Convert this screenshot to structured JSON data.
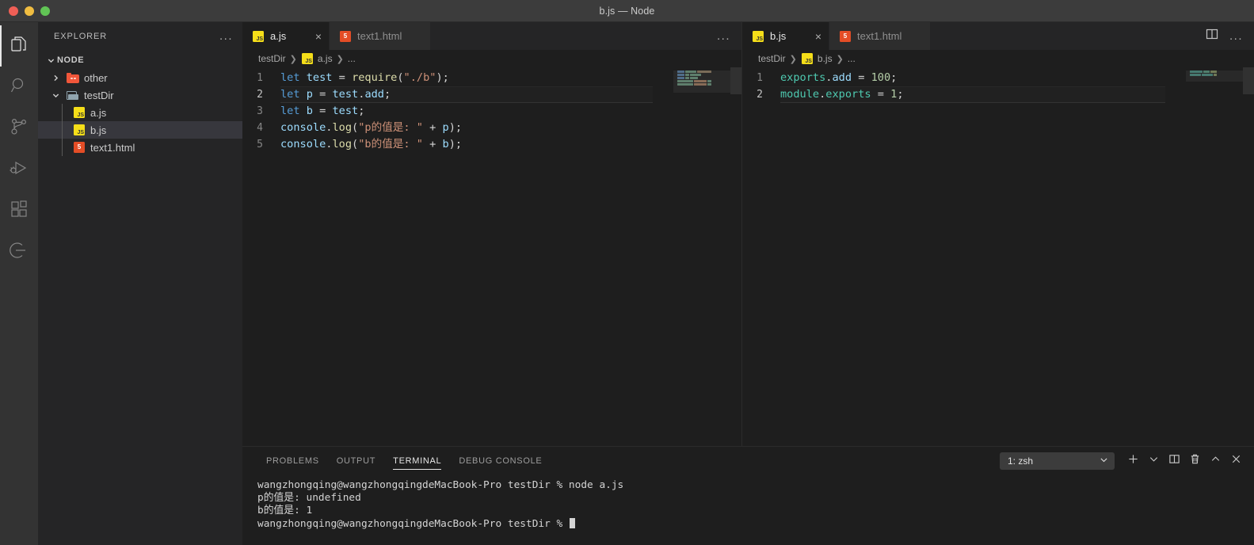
{
  "window": {
    "title": "b.js — Node",
    "traffic_lights": [
      "close",
      "minimize",
      "maximize"
    ]
  },
  "activitybar": {
    "items": [
      {
        "name": "explorer",
        "icon": "files-icon",
        "active": true
      },
      {
        "name": "search",
        "icon": "search-icon",
        "active": false
      },
      {
        "name": "source-control",
        "icon": "source-control-icon",
        "active": false
      },
      {
        "name": "run-and-debug",
        "icon": "run-debug-icon",
        "active": false
      },
      {
        "name": "extensions",
        "icon": "extensions-icon",
        "active": false
      },
      {
        "name": "remote-explorer",
        "icon": "remote-plug-icon",
        "active": false
      }
    ]
  },
  "sidebar": {
    "header": {
      "title": "EXPLORER",
      "more_actions": "..."
    },
    "root": {
      "label": "NODE",
      "expanded": true
    },
    "tree": [
      {
        "label": "other",
        "type": "folder",
        "icon": "folder-node-icon",
        "expanded": false,
        "indent": 1,
        "selected": false
      },
      {
        "label": "testDir",
        "type": "folder",
        "icon": "folder-open-icon",
        "expanded": true,
        "indent": 1,
        "selected": false
      },
      {
        "label": "a.js",
        "type": "file",
        "icon": "js-file-icon",
        "indent": 2,
        "selected": false
      },
      {
        "label": "b.js",
        "type": "file",
        "icon": "js-file-icon",
        "indent": 2,
        "selected": true
      },
      {
        "label": "text1.html",
        "type": "file",
        "icon": "html-file-icon",
        "indent": 2,
        "selected": false
      }
    ]
  },
  "editor_groups": [
    {
      "id": "left",
      "tabs": [
        {
          "label": "a.js",
          "icon": "js-file-icon",
          "active": true,
          "close": "×"
        },
        {
          "label": "text1.html",
          "icon": "html-file-icon",
          "active": false,
          "close": "×"
        }
      ],
      "actions": {
        "more": "..."
      },
      "breadcrumb": [
        {
          "label": "testDir",
          "icon": null
        },
        {
          "label": "a.js",
          "icon": "js-file-icon"
        },
        {
          "label": "...",
          "icon": null
        }
      ],
      "lines": [
        {
          "n": "1",
          "current": false,
          "tokens": [
            {
              "t": "let",
              "c": "kw"
            },
            {
              "t": " ",
              "c": "plain"
            },
            {
              "t": "test",
              "c": "var"
            },
            {
              "t": " ",
              "c": "plain"
            },
            {
              "t": "=",
              "c": "plain"
            },
            {
              "t": " ",
              "c": "plain"
            },
            {
              "t": "require",
              "c": "fn"
            },
            {
              "t": "(",
              "c": "plain"
            },
            {
              "t": "\"./b\"",
              "c": "str"
            },
            {
              "t": ");",
              "c": "plain"
            }
          ]
        },
        {
          "n": "2",
          "current": true,
          "tokens": [
            {
              "t": "let",
              "c": "kw"
            },
            {
              "t": " ",
              "c": "plain"
            },
            {
              "t": "p",
              "c": "var"
            },
            {
              "t": " = ",
              "c": "plain"
            },
            {
              "t": "test",
              "c": "var"
            },
            {
              "t": ".",
              "c": "plain"
            },
            {
              "t": "add",
              "c": "var"
            },
            {
              "t": ";",
              "c": "plain"
            }
          ]
        },
        {
          "n": "3",
          "current": false,
          "tokens": [
            {
              "t": "let",
              "c": "kw"
            },
            {
              "t": " ",
              "c": "plain"
            },
            {
              "t": "b",
              "c": "var"
            },
            {
              "t": " = ",
              "c": "plain"
            },
            {
              "t": "test",
              "c": "var"
            },
            {
              "t": ";",
              "c": "plain"
            }
          ]
        },
        {
          "n": "4",
          "current": false,
          "tokens": [
            {
              "t": "console",
              "c": "var"
            },
            {
              "t": ".",
              "c": "plain"
            },
            {
              "t": "log",
              "c": "fn"
            },
            {
              "t": "(",
              "c": "plain"
            },
            {
              "t": "\"p的值是: \"",
              "c": "str"
            },
            {
              "t": " + ",
              "c": "plain"
            },
            {
              "t": "p",
              "c": "var"
            },
            {
              "t": ");",
              "c": "plain"
            }
          ]
        },
        {
          "n": "5",
          "current": false,
          "tokens": [
            {
              "t": "console",
              "c": "var"
            },
            {
              "t": ".",
              "c": "plain"
            },
            {
              "t": "log",
              "c": "fn"
            },
            {
              "t": "(",
              "c": "plain"
            },
            {
              "t": "\"b的值是: \"",
              "c": "str"
            },
            {
              "t": " + ",
              "c": "plain"
            },
            {
              "t": "b",
              "c": "var"
            },
            {
              "t": ");",
              "c": "plain"
            }
          ]
        }
      ]
    },
    {
      "id": "right",
      "tabs": [
        {
          "label": "b.js",
          "icon": "js-file-icon",
          "active": true,
          "close": "×"
        },
        {
          "label": "text1.html",
          "icon": "html-file-icon",
          "active": false,
          "close": "×"
        }
      ],
      "actions": {
        "split_editor": "split-editor-icon",
        "more": "..."
      },
      "breadcrumb": [
        {
          "label": "testDir",
          "icon": null
        },
        {
          "label": "b.js",
          "icon": "js-file-icon"
        },
        {
          "label": "...",
          "icon": null
        }
      ],
      "lines": [
        {
          "n": "1",
          "current": false,
          "tokens": [
            {
              "t": "exports",
              "c": "teal"
            },
            {
              "t": ".",
              "c": "plain"
            },
            {
              "t": "add",
              "c": "var"
            },
            {
              "t": " = ",
              "c": "plain"
            },
            {
              "t": "100",
              "c": "num"
            },
            {
              "t": ";",
              "c": "plain"
            }
          ]
        },
        {
          "n": "2",
          "current": true,
          "tokens": [
            {
              "t": "module",
              "c": "teal"
            },
            {
              "t": ".",
              "c": "plain"
            },
            {
              "t": "exports",
              "c": "teal"
            },
            {
              "t": " = ",
              "c": "plain"
            },
            {
              "t": "1",
              "c": "num"
            },
            {
              "t": ";",
              "c": "plain"
            }
          ]
        }
      ]
    }
  ],
  "panel": {
    "tabs": [
      {
        "label": "PROBLEMS",
        "active": false
      },
      {
        "label": "OUTPUT",
        "active": false
      },
      {
        "label": "TERMINAL",
        "active": true
      },
      {
        "label": "DEBUG CONSOLE",
        "active": false
      }
    ],
    "terminal_selector": {
      "value": "1: zsh",
      "chevron": "chevron-down-icon"
    },
    "actions": [
      {
        "name": "new-terminal",
        "icon": "plus-icon"
      },
      {
        "name": "terminal-options",
        "icon": "chevron-down-icon"
      },
      {
        "name": "split-terminal",
        "icon": "split-icon"
      },
      {
        "name": "kill-terminal",
        "icon": "trash-icon"
      },
      {
        "name": "maximize-panel",
        "icon": "chevron-up-icon"
      },
      {
        "name": "close-panel",
        "icon": "close-icon"
      }
    ],
    "terminal_lines": [
      "wangzhongqing@wangzhongqingdeMacBook-Pro testDir % node a.js",
      "p的值是: undefined",
      "b的值是: 1",
      "wangzhongqing@wangzhongqingdeMacBook-Pro testDir % "
    ]
  },
  "colors": {
    "titlebar_bg": "#3c3c3c",
    "activitybar_bg": "#333333",
    "sidebar_bg": "#252526",
    "editor_bg": "#1e1e1e",
    "tab_active_bg": "#1e1e1e",
    "tab_inactive_bg": "#2d2d2d",
    "selection_bg": "#37373d",
    "keyword": "#569cd6",
    "variable": "#9cdcfe",
    "function": "#dcdcaa",
    "string": "#ce9178",
    "number": "#b5cea8",
    "class_teal": "#4ec9b0",
    "foreground": "#cccccc"
  }
}
